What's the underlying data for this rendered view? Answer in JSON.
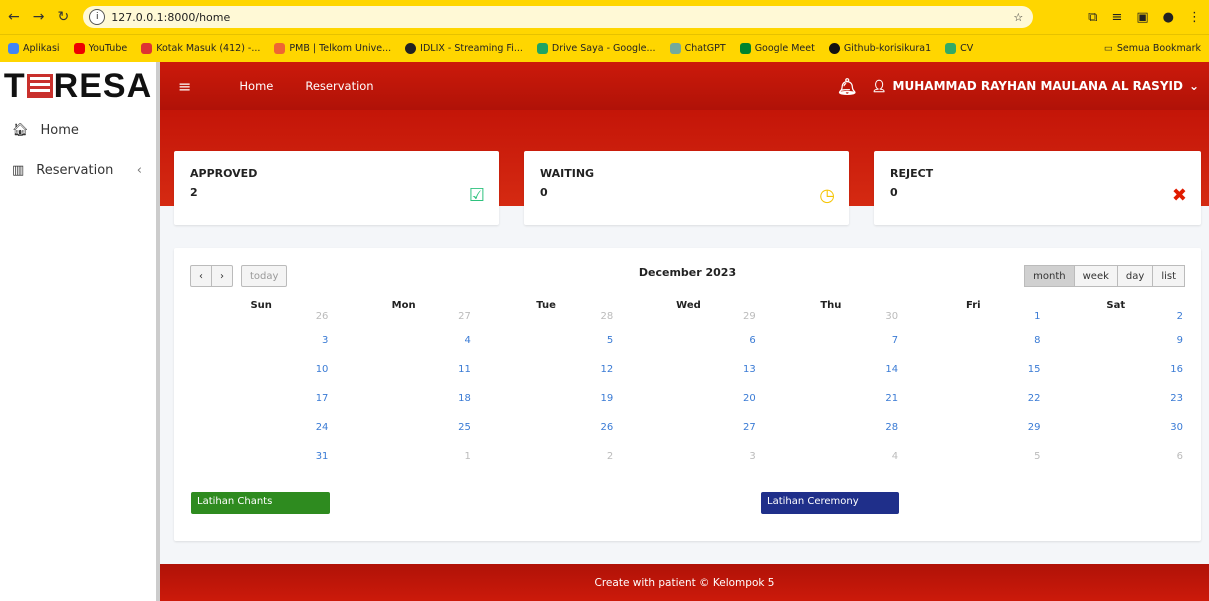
{
  "browser": {
    "url": "127.0.0.1:8000/home",
    "bookmarks": [
      "Aplikasi",
      "YouTube",
      "Kotak Masuk (412) -...",
      "PMB | Telkom Unive...",
      "IDLIX - Streaming Fi...",
      "Drive Saya - Google...",
      "ChatGPT",
      "Google Meet",
      "Github-korisikura1",
      "CV"
    ],
    "all_bookmarks": "Semua Bookmark"
  },
  "sidebar": {
    "logo_left": "T",
    "logo_right": "RESA",
    "items": [
      {
        "label": "Home"
      },
      {
        "label": "Reservation"
      }
    ]
  },
  "topbar": {
    "menu": [
      "Home",
      "Reservation"
    ],
    "user": "MUHAMMAD RAYHAN MAULANA AL RASYID"
  },
  "cards": [
    {
      "title": "APPROVED",
      "value": "2",
      "icon": "check-square-icon",
      "color": "#2ec27e"
    },
    {
      "title": "WAITING",
      "value": "0",
      "icon": "clock-icon",
      "color": "#f5c400"
    },
    {
      "title": "REJECT",
      "value": "0",
      "icon": "cross-icon",
      "color": "#e01b00"
    }
  ],
  "calendar": {
    "title": "December 2023",
    "today_label": "today",
    "views": [
      "month",
      "week",
      "day",
      "list"
    ],
    "days": [
      "Sun",
      "Mon",
      "Tue",
      "Wed",
      "Thu",
      "Fri",
      "Sat"
    ],
    "weeks": [
      [
        "26",
        "27",
        "28",
        "29",
        "30",
        "1",
        "2"
      ],
      [
        "3",
        "4",
        "5",
        "6",
        "7",
        "8",
        "9"
      ],
      [
        "10",
        "11",
        "12",
        "13",
        "14",
        "15",
        "16"
      ],
      [
        "17",
        "18",
        "19",
        "20",
        "21",
        "22",
        "23"
      ],
      [
        "24",
        "25",
        "26",
        "27",
        "28",
        "29",
        "30"
      ],
      [
        "31",
        "1",
        "2",
        "3",
        "4",
        "5",
        "6"
      ]
    ],
    "events": [
      {
        "title": "Latihan Chants",
        "color": "#2e8b1f"
      },
      {
        "title": "Latihan Ceremony",
        "color": "#1f2f8a"
      }
    ]
  },
  "footer": "Create with patient © Kelompok 5"
}
